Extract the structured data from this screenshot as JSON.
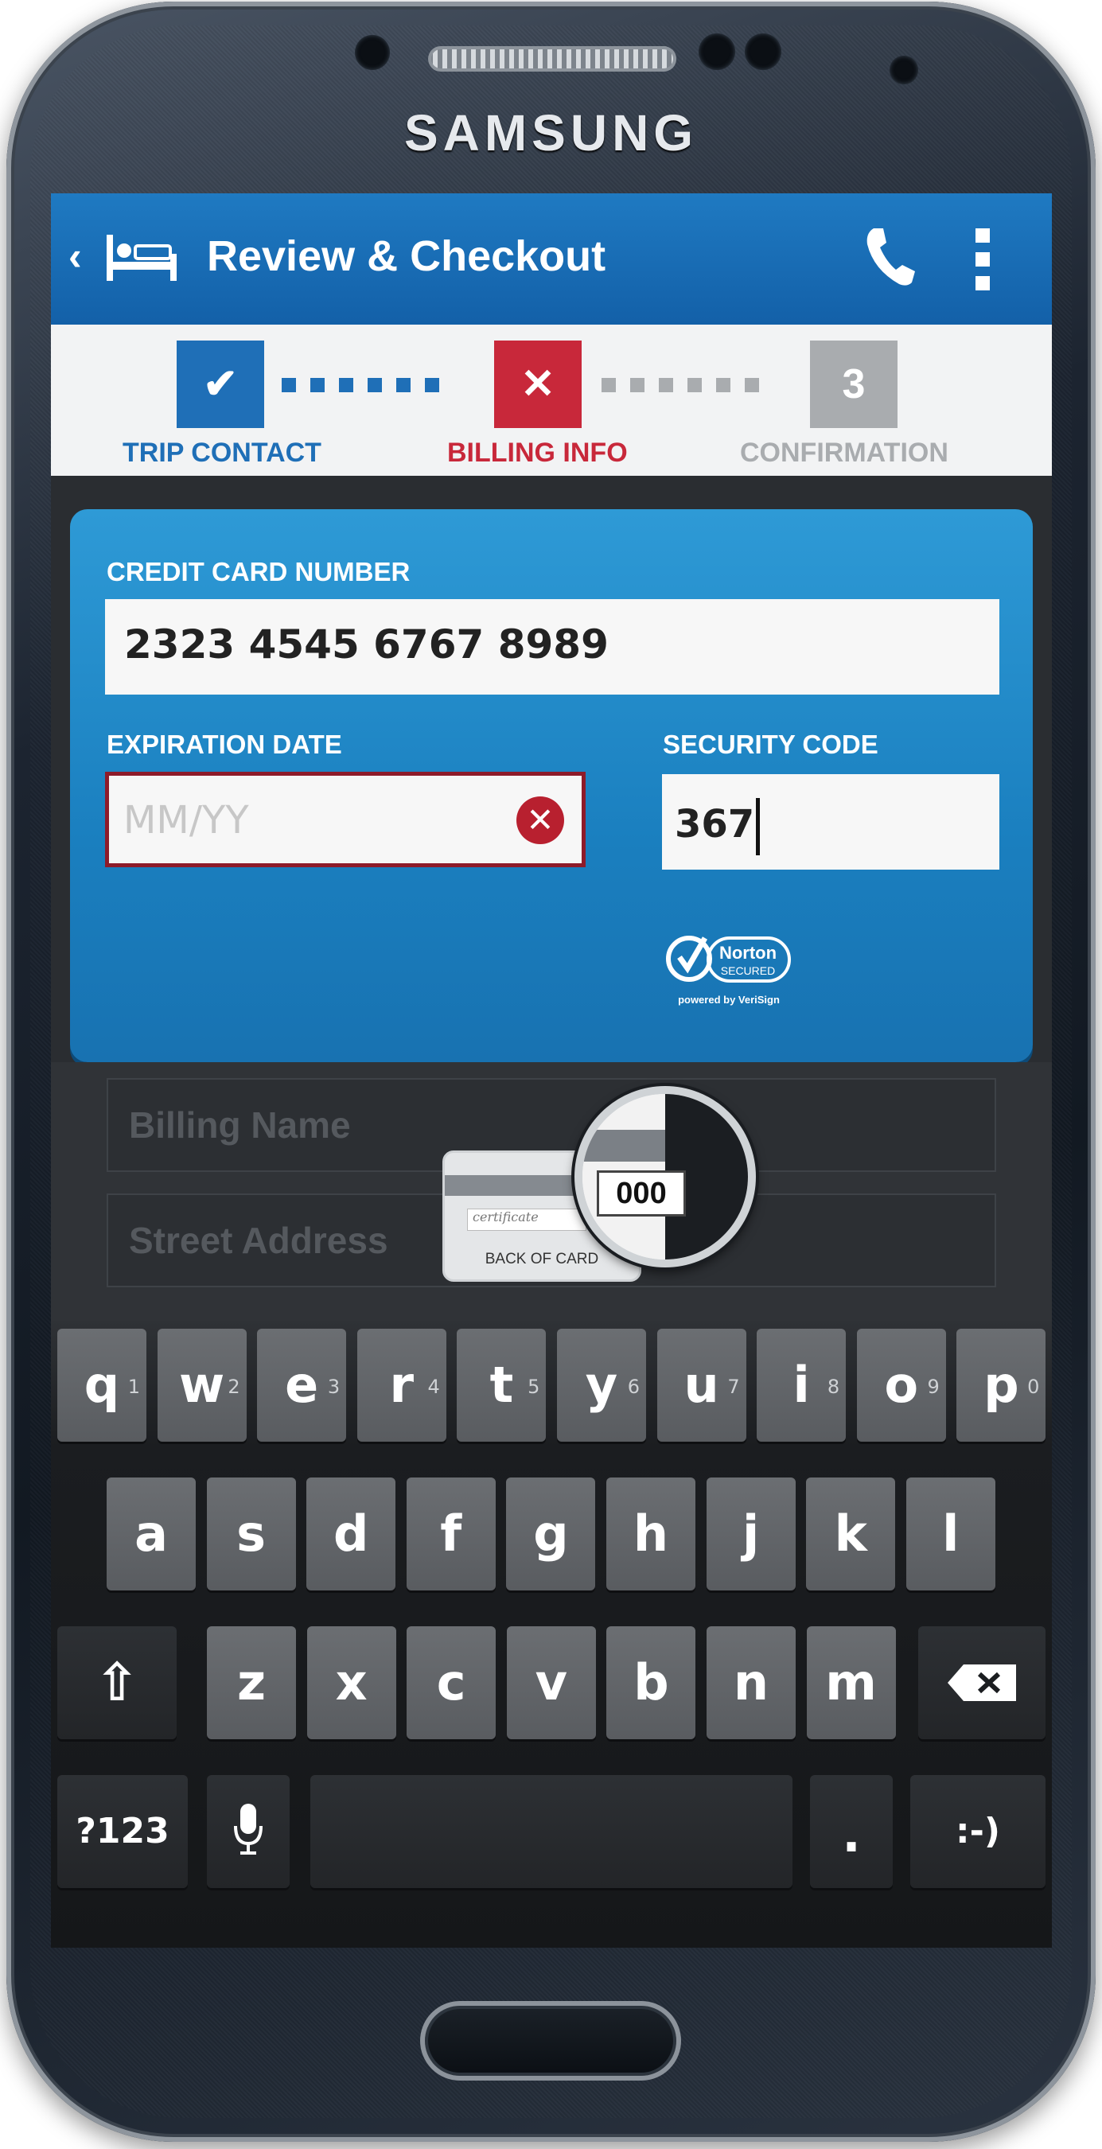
{
  "device": {
    "brand": "SAMSUNG"
  },
  "app_bar": {
    "back_glyph": "‹",
    "title": "Review & Checkout"
  },
  "stepper": {
    "steps": [
      {
        "label": "TRIP CONTACT",
        "state": "done",
        "glyph": "✔",
        "color": "#1f6fb7"
      },
      {
        "label": "BILLING INFO",
        "state": "error",
        "glyph": "✕",
        "color": "#c8283a"
      },
      {
        "label": "CONFIRMATION",
        "state": "pending",
        "glyph": "3",
        "color": "#a9acaf"
      }
    ]
  },
  "card_form": {
    "card_number_label": "CREDIT CARD NUMBER",
    "card_number_value": "2323 4545 6767 8989",
    "expiration_label": "EXPIRATION DATE",
    "expiration_placeholder": "MM/YY",
    "expiration_error_glyph": "✕",
    "security_label": "SECURITY CODE",
    "security_value": "367",
    "norton": {
      "name": "Norton",
      "secured": "SECURED",
      "powered": "powered by VeriSign"
    }
  },
  "billing_form": {
    "billing_name_placeholder": "Billing Name",
    "street_address_placeholder": "Street Address"
  },
  "cvv_hint": {
    "caption": "BACK OF CARD",
    "code": "000",
    "signature": "certificate"
  },
  "keyboard": {
    "row1": [
      {
        "key": "q",
        "alt": "1"
      },
      {
        "key": "w",
        "alt": "2"
      },
      {
        "key": "e",
        "alt": "3"
      },
      {
        "key": "r",
        "alt": "4"
      },
      {
        "key": "t",
        "alt": "5"
      },
      {
        "key": "y",
        "alt": "6"
      },
      {
        "key": "u",
        "alt": "7"
      },
      {
        "key": "i",
        "alt": "8"
      },
      {
        "key": "o",
        "alt": "9"
      },
      {
        "key": "p",
        "alt": "0"
      }
    ],
    "row2": [
      "a",
      "s",
      "d",
      "f",
      "g",
      "h",
      "j",
      "k",
      "l"
    ],
    "row3": [
      "z",
      "x",
      "c",
      "v",
      "b",
      "n",
      "m"
    ],
    "shift_glyph": "⇧",
    "numbers_label": "?123",
    "period_label": ".",
    "emoticon_label": ":-)"
  },
  "colors": {
    "app_bar": "#1f7ac2",
    "error": "#c8283a",
    "card_panel": "#2e9ad6"
  }
}
